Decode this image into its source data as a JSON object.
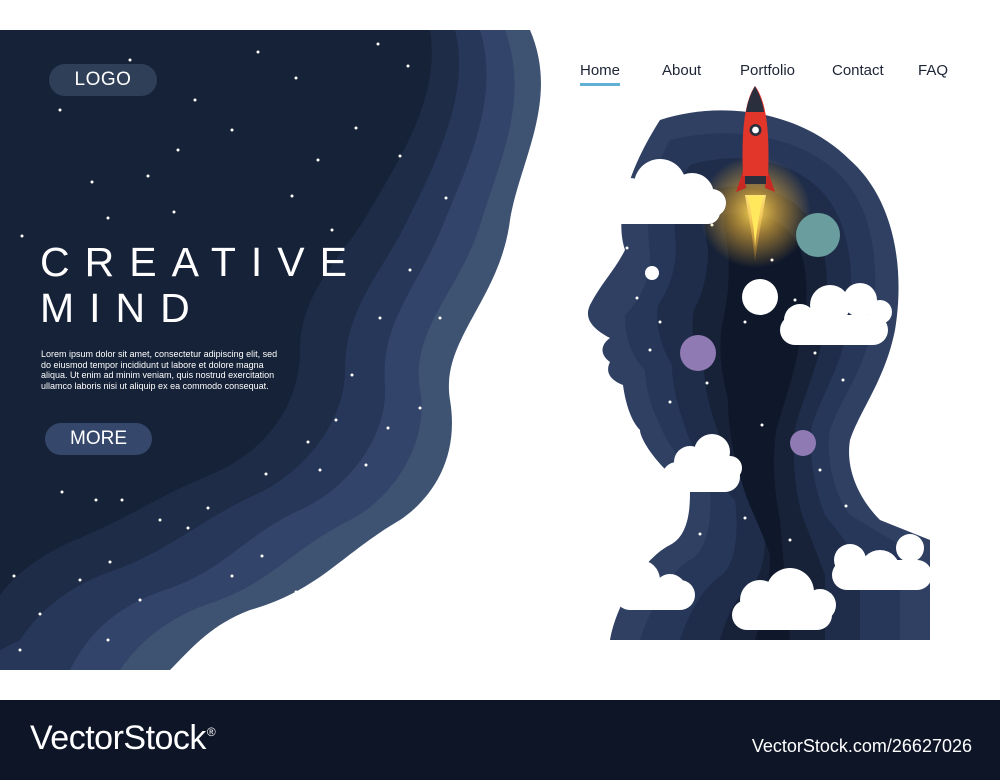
{
  "logo": {
    "label": "LOGO"
  },
  "nav": {
    "items": [
      {
        "label": "Home",
        "active": true
      },
      {
        "label": "About",
        "active": false
      },
      {
        "label": "Portfolio",
        "active": false
      },
      {
        "label": "Contact",
        "active": false
      },
      {
        "label": "FAQ",
        "active": false
      }
    ]
  },
  "hero": {
    "title_line1": "CREATIVE",
    "title_line2": "MIND",
    "body": "Lorem ipsum dolor sit amet, consectetur adipiscing elit, sed do eiusmod tempor incididunt ut labore et dolore magna aliqua. Ut enim ad minim veniam, quis nostrud exercitation ullamco laboris nisi ut aliquip ex ea commodo consequat.",
    "more_label": "MORE"
  },
  "illustration": {
    "icons": [
      "rocket-icon",
      "planet-icon",
      "cloud-icon",
      "star-icon",
      "head-silhouette"
    ]
  },
  "footer": {
    "brand": "VectorStock",
    "brand_mark": "®",
    "image_id": "VectorStock.com/26627026"
  },
  "colors": {
    "navy_darkest": "#141d30",
    "navy_mid": "#24314a",
    "navy_light": "#3b4d6e",
    "accent_underline": "#5fb0d4",
    "rocket_red": "#e2362b",
    "planet_teal": "#6a9e9e",
    "planet_purple": "#8f7ab3",
    "footer_bg": "#0d1527"
  }
}
